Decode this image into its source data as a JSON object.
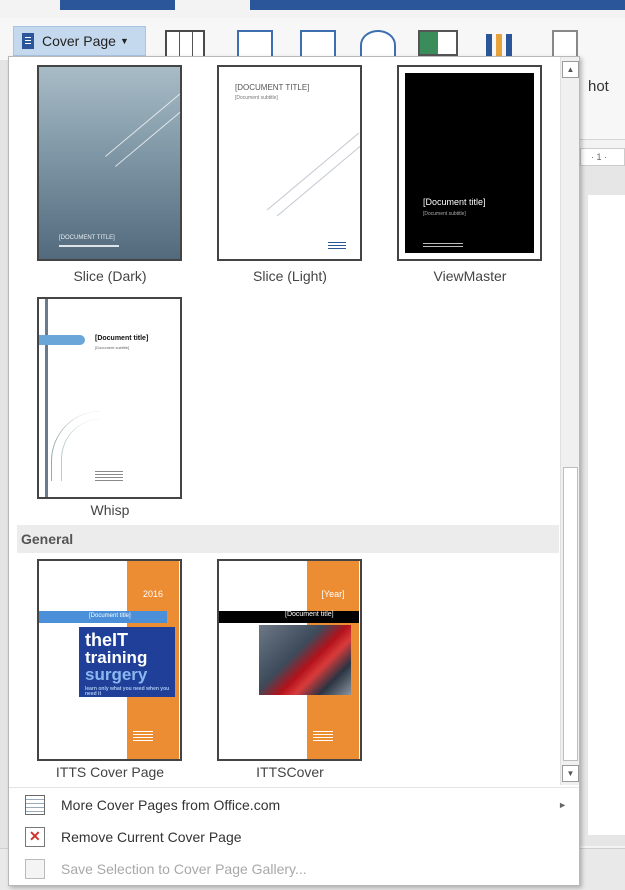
{
  "ribbon": {
    "cover_button_label": "Cover Page",
    "screenshot_label_partial": "hot",
    "ruler_partial": "· 1 ·"
  },
  "gallery": {
    "built_in_items": [
      {
        "label": "Slice (Dark)",
        "preview_title": "[DOCUMENT TITLE]"
      },
      {
        "label": "Slice (Light)",
        "preview_title": "[DOCUMENT TITLE]",
        "preview_subtitle": "[Document subtitle]"
      },
      {
        "label": "ViewMaster",
        "preview_title": "[Document title]",
        "preview_subtitle": "[Document subtitle]"
      },
      {
        "label": "Whisp",
        "preview_title": "[Document title]",
        "preview_subtitle": "[Document subtitle]"
      }
    ],
    "general_header": "General",
    "general_items": [
      {
        "label": "ITTS Cover Page",
        "year": "2016",
        "preview_title": "[Document title]",
        "logo_line1": "theIT",
        "logo_line2": "training",
        "logo_line3": "surgery",
        "tagline": "learn only what you need when you need it"
      },
      {
        "label": "ITTSCover",
        "year": "[Year]",
        "preview_title": "[Document title]"
      }
    ]
  },
  "menu": {
    "more": "More Cover Pages from Office.com",
    "remove": "Remove Current Cover Page",
    "save": "Save Selection to Cover Page Gallery..."
  },
  "colors": {
    "accent_blue": "#2b579a",
    "orange": "#ec8c33",
    "remove_red": "#d0312d"
  }
}
